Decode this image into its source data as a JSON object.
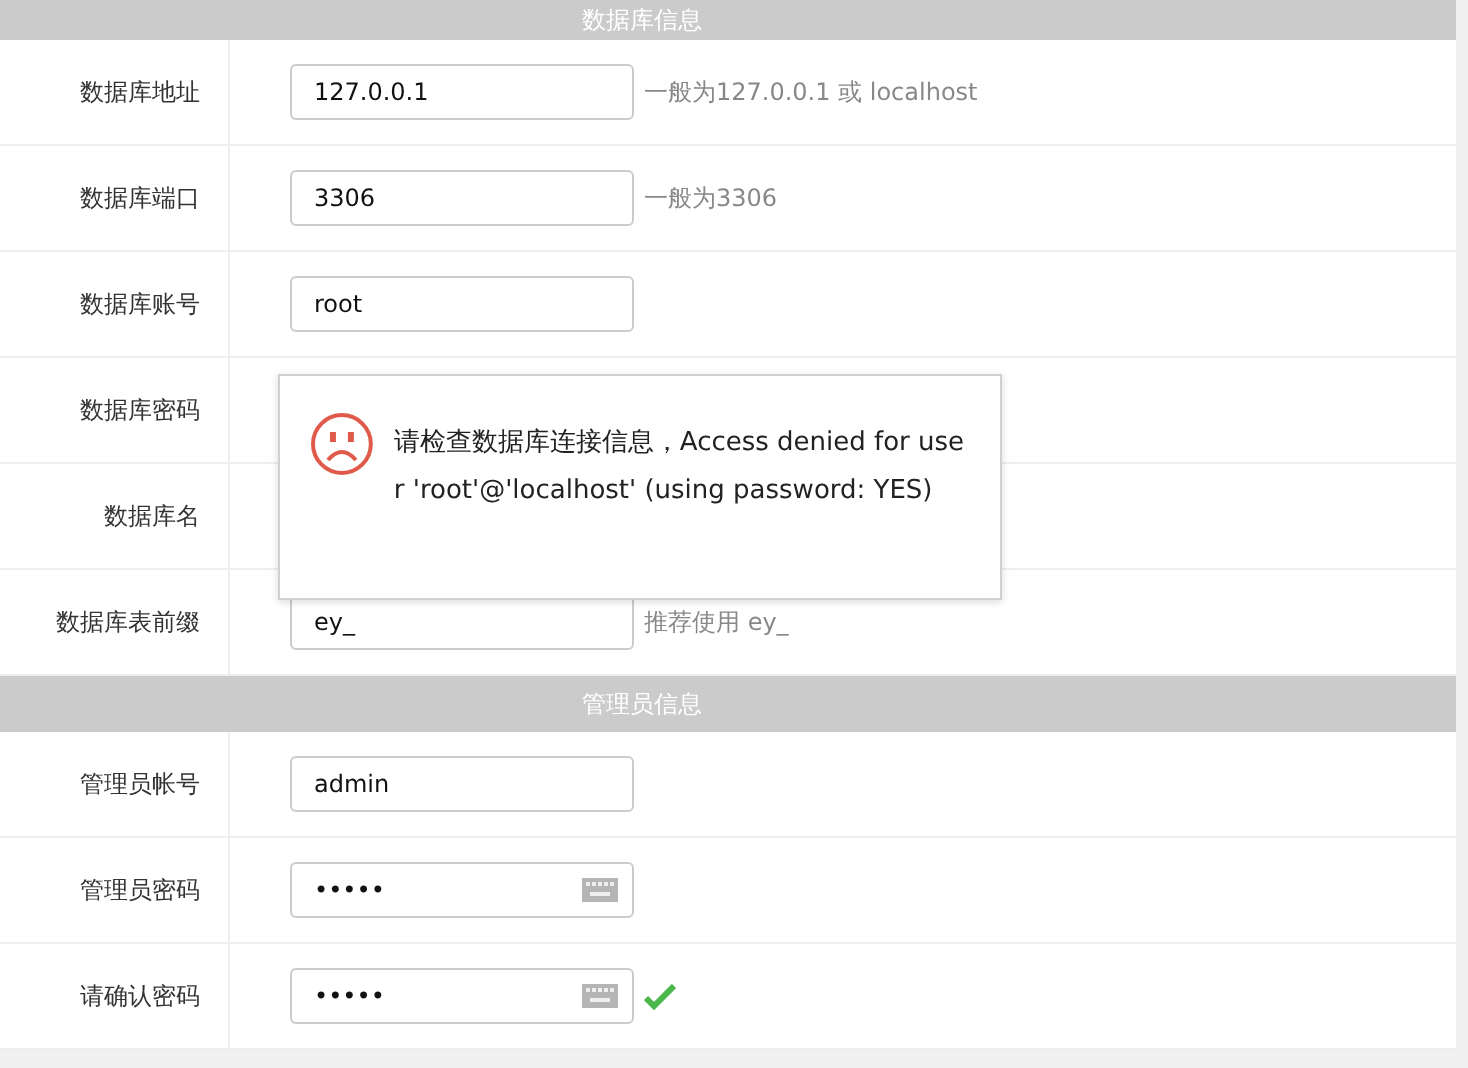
{
  "sections": [
    {
      "title": "数据库信息",
      "rows": [
        {
          "label": "数据库地址",
          "kind": "text",
          "value": "127.0.0.1",
          "hint": "一般为127.0.0.1 或 localhost"
        },
        {
          "label": "数据库端口",
          "kind": "text",
          "value": "3306",
          "hint": "一般为3306"
        },
        {
          "label": "数据库账号",
          "kind": "text",
          "value": "root"
        },
        {
          "label": "数据库密码",
          "kind": "hidden"
        },
        {
          "label": "数据库名",
          "kind": "hidden"
        },
        {
          "label": "数据库表前缀",
          "kind": "text",
          "value": "ey_",
          "hint": "推荐使用 ey_"
        }
      ]
    },
    {
      "title": "管理员信息",
      "rows": [
        {
          "label": "管理员帐号",
          "kind": "text",
          "value": "admin"
        },
        {
          "label": "管理员密码",
          "kind": "password",
          "value": "•••••",
          "valid": false
        },
        {
          "label": "请确认密码",
          "kind": "password",
          "value": "•••••",
          "valid": true
        }
      ]
    }
  ],
  "error_dialog": {
    "message": "请检查数据库连接信息，Access denied for user 'root'@'localhost' (using password: YES)"
  }
}
